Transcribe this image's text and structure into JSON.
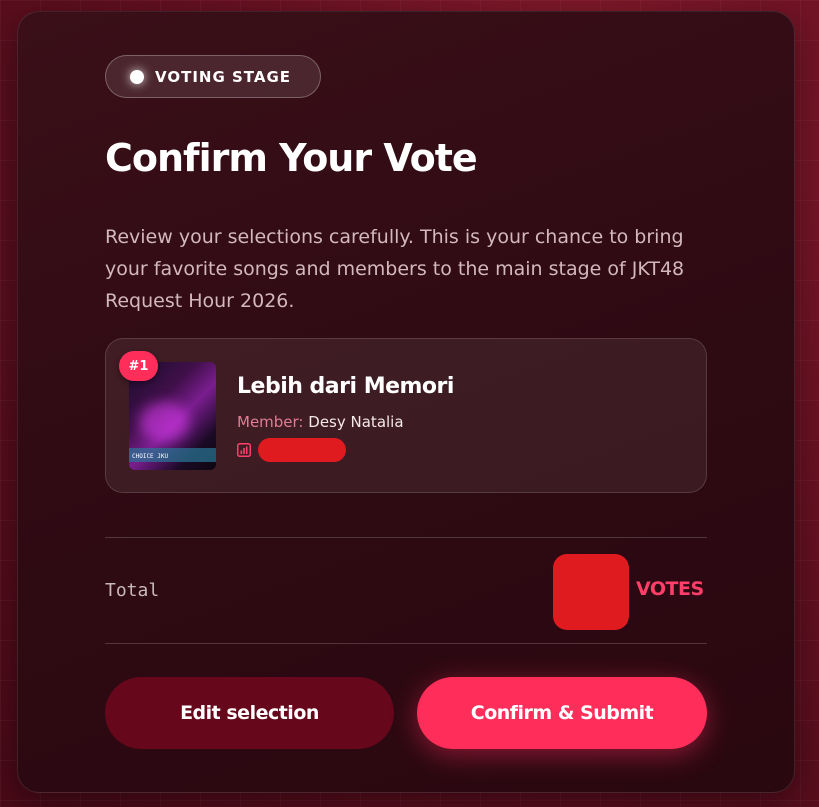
{
  "badge": {
    "label": "VOTING STAGE"
  },
  "header": {
    "title": "Confirm Your Vote",
    "description": "Review your selections carefully. This is your chance to bring your favorite songs and members to the main stage of JKT48 Request Hour 2026."
  },
  "selection": {
    "rank": "#1",
    "song_title": "Lebih dari Memori",
    "member_label": "Member:",
    "member_name": "Desy Natalia",
    "thumbnail_caption": "CHOICE JKU"
  },
  "summary": {
    "total_label": "Total",
    "votes_unit": "VOTES"
  },
  "actions": {
    "edit_label": "Edit selection",
    "confirm_label": "Confirm & Submit"
  },
  "colors": {
    "accent": "#ff2d5a",
    "votes_text": "#ff3f69",
    "edit_button": "#66071b",
    "member_label": "#e37d95",
    "redaction": "#e01b20"
  },
  "icons": {
    "status_dot": "dot-icon",
    "stats": "bar-chart-icon"
  }
}
